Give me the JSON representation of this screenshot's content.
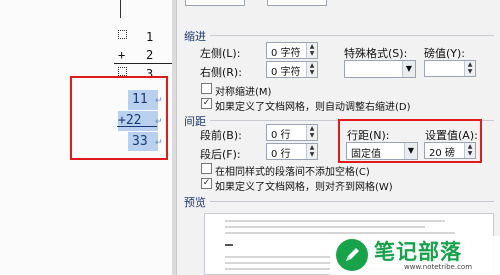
{
  "document": {
    "rows": [
      {
        "marker": "",
        "number": "1"
      },
      {
        "marker": "+",
        "number": "2"
      },
      {
        "marker": "",
        "number": "3"
      }
    ],
    "selected": [
      "11",
      "+22",
      "33"
    ],
    "paragraph_mark": "↵"
  },
  "dialog": {
    "indent": {
      "section_label": "缩进",
      "left_label": "左侧(L):",
      "left_value": "0 字符",
      "right_label": "右侧(R):",
      "right_value": "0 字符",
      "special_label": "特殊格式(S):",
      "special_value": "",
      "amount_label": "磅值(Y):",
      "amount_value": "",
      "mirror_label": "对称缩进(M)",
      "mirror_checked": false,
      "auto_label": "如果定义了文档网格，则自动调整右缩进(D)",
      "auto_checked": true
    },
    "spacing": {
      "section_label": "间距",
      "before_label": "段前(B):",
      "before_value": "0 行",
      "after_label": "段后(F):",
      "after_value": "0 行",
      "line_spacing_label": "行距(N):",
      "line_spacing_value": "固定值",
      "setting_label": "设置值(A):",
      "setting_value": "20 磅",
      "no_space_label": "在相同样式的段落间不添加空格(C)",
      "no_space_checked": false,
      "snap_label": "如果定义了文档网格，则对齐到网格(W)",
      "snap_checked": true
    },
    "preview": {
      "section_label": "预览"
    }
  },
  "watermark": {
    "title": "笔记部落",
    "url": "www.notetribe.com"
  }
}
